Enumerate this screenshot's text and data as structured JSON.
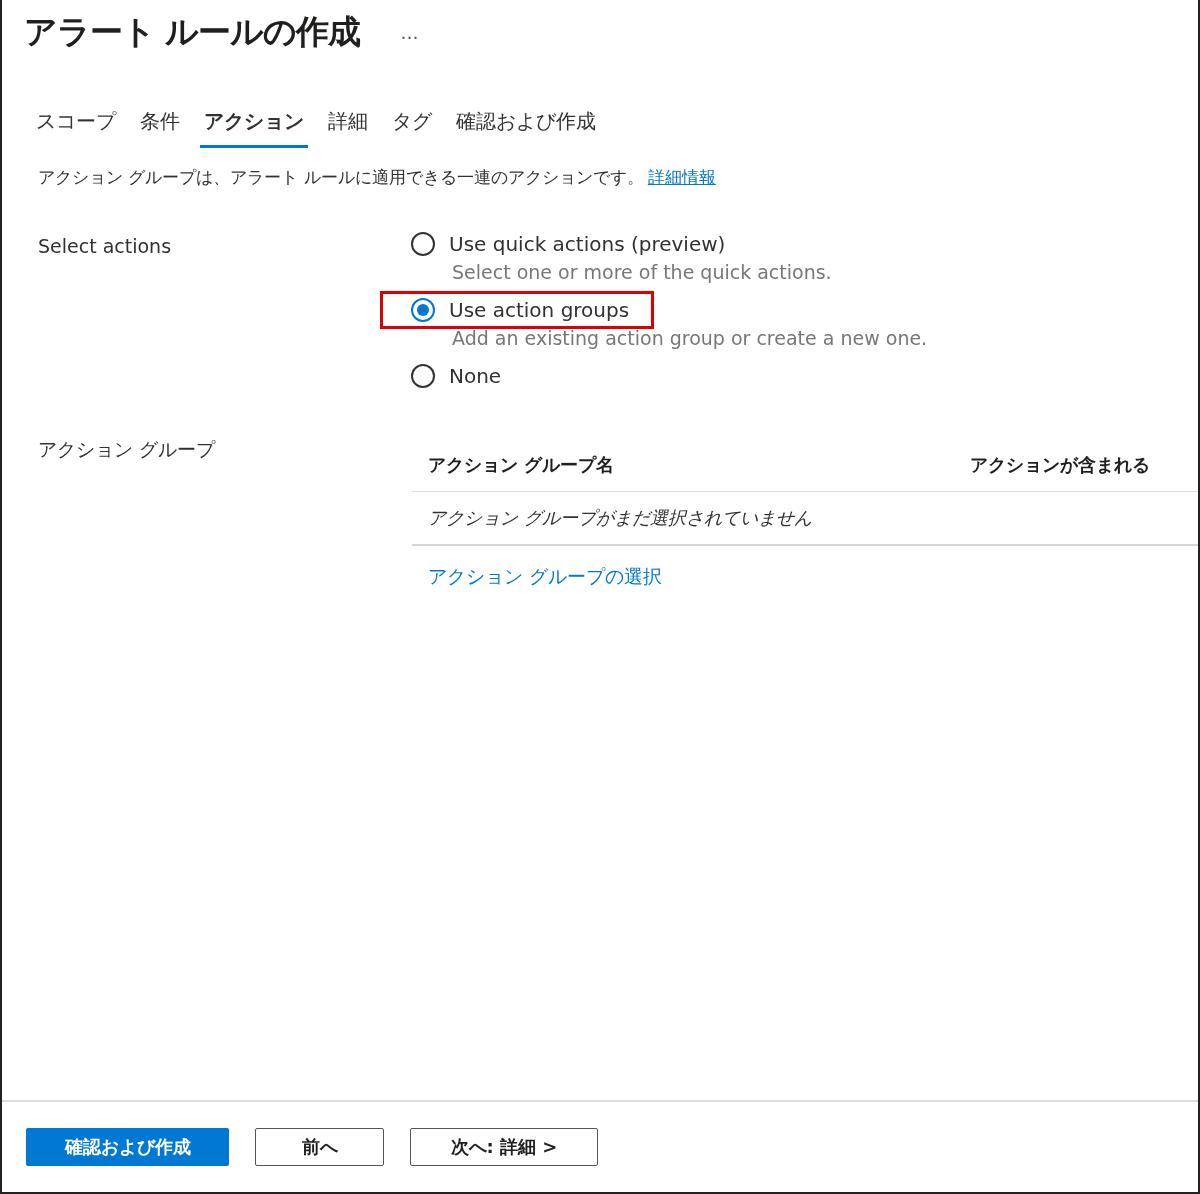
{
  "title": "アラート ルールの作成",
  "more": "…",
  "tabs": [
    {
      "label": "スコープ",
      "selected": false
    },
    {
      "label": "条件",
      "selected": false
    },
    {
      "label": "アクション",
      "selected": true
    },
    {
      "label": "詳細",
      "selected": false
    },
    {
      "label": "タグ",
      "selected": false
    },
    {
      "label": "確認および作成",
      "selected": false
    }
  ],
  "description": {
    "text": "アクション グループは、アラート ルールに適用できる一連のアクションです。",
    "link": "詳細情報"
  },
  "select_actions": {
    "label": "Select actions",
    "options": [
      {
        "label": "Use quick actions (preview)",
        "hint": "Select one or more of the quick actions.",
        "selected": false,
        "highlighted": false
      },
      {
        "label": "Use action groups",
        "hint": "Add an existing action group or create a new one.",
        "selected": true,
        "highlighted": true
      },
      {
        "label": "None",
        "selected": false,
        "highlighted": false
      }
    ]
  },
  "action_groups": {
    "label": "アクション グループ",
    "columns": [
      "アクション グループ名",
      "アクションが含まれる"
    ],
    "empty_message": "アクション グループがまだ選択されていません",
    "select_link": "アクション グループの選択"
  },
  "buttons": [
    {
      "label": "確認および作成",
      "kind": "primary"
    },
    {
      "label": "前へ",
      "kind": "secondary"
    },
    {
      "label": "次へ: 詳細 >",
      "kind": "secondary"
    }
  ]
}
